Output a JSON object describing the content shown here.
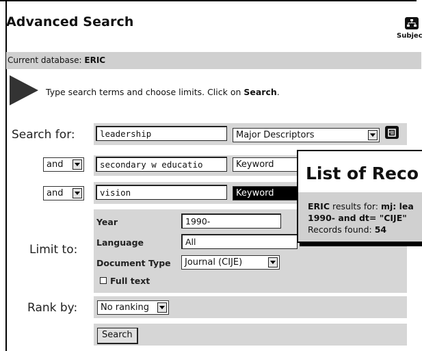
{
  "header": {
    "title": "Advanced Search",
    "subject_label": "Subjec"
  },
  "database": {
    "prefix": "Current database: ",
    "name": "ERIC"
  },
  "instructions": {
    "text": "Type search terms and choose limits. Click on ",
    "emphasis": "Search",
    "suffix": "."
  },
  "search": {
    "label": "Search for:",
    "rows": [
      {
        "term": "leadership",
        "field": "Major Descriptors"
      },
      {
        "operator": "and",
        "term": "secondary w educatio",
        "field": "Keyword"
      },
      {
        "operator": "and",
        "term": "vision",
        "field": "Keyword"
      }
    ]
  },
  "limits": {
    "label": "Limit to:",
    "year_label": "Year",
    "year_value": "1990-",
    "language_label": "Language",
    "language_value": "All",
    "doctype_label": "Document Type",
    "doctype_value": "Journal (CIJE)",
    "fulltext_label": "Full text",
    "fulltext_checked": false
  },
  "rank": {
    "label": "Rank by:",
    "value": "No ranking"
  },
  "actions": {
    "search_button": "Search"
  },
  "popup": {
    "title": "List of Reco",
    "line1_db": "ERIC",
    "line1_text": " results for: ",
    "line1_query": "mj: lea",
    "line2": "1990- and dt= \"CIJE\"",
    "line3_label": "Records found: ",
    "line3_count": "54"
  },
  "colors": {
    "bar_gray": "#d0d0d0",
    "form_gray": "#d6d6d6",
    "highlight": "#000000"
  }
}
